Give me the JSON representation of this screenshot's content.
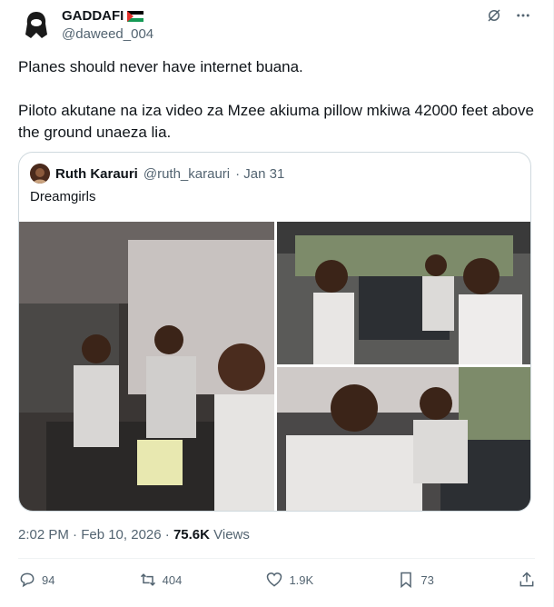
{
  "author": {
    "name": "GADDAFI",
    "handle": "@daweed_004",
    "flag_icon": "palestine-flag-icon"
  },
  "tweet": {
    "lines": [
      "Planes should never have internet buana.",
      "Piloto akutane na iza video za Mzee akiuma pillow mkiwa 42000 feet above the ground unaeza lia."
    ]
  },
  "quote": {
    "name": "Ruth Karauri",
    "handle": "@ruth_karauri",
    "date": "· Jan 31",
    "text": "Dreamgirls"
  },
  "meta": {
    "time": "2:02 PM · Feb 10, 2026 ·",
    "views_count": "75.6K",
    "views_label": "Views"
  },
  "actions": {
    "replies": "94",
    "reposts": "404",
    "likes": "1.9K",
    "bookmarks": "73"
  },
  "colors": {
    "text": "#0f1419",
    "secondary": "#536471",
    "border": "#cfd9de"
  }
}
